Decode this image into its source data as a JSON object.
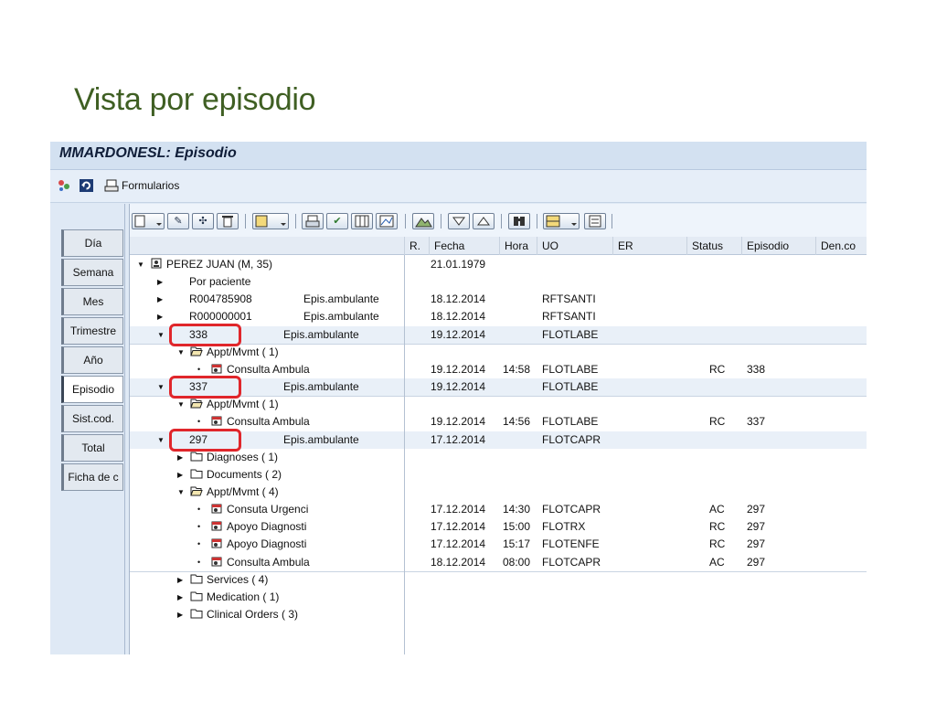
{
  "slide_title": "Vista por episodio",
  "window_title": "MMARDONESL: Episodio",
  "app_toolbar": {
    "forms_label": "Formularios"
  },
  "tabs": [
    "Día",
    "Semana",
    "Mes",
    "Trimestre",
    "Año",
    "Episodio",
    "Sist.cod.",
    "Total",
    "Ficha de c"
  ],
  "active_tab": "Episodio",
  "columns": [
    "R.",
    "Fecha",
    "Hora",
    "UO",
    "ER",
    "Status",
    "Episodio",
    "Den.co"
  ],
  "rows": [
    {
      "label": "PEREZ JUAN (M, 35)",
      "desc": "",
      "fecha": "21.01.1979",
      "hora": "",
      "uo": "",
      "status": "",
      "episodio": "",
      "level": 0,
      "node": "open",
      "icon": "patient-icon"
    },
    {
      "label": "Por paciente",
      "desc": "",
      "fecha": "",
      "hora": "",
      "uo": "",
      "status": "",
      "episodio": "",
      "level": 1,
      "node": "closed",
      "icon": ""
    },
    {
      "label": "R004785908",
      "desc": "Epis.ambulante",
      "fecha": "18.12.2014",
      "hora": "",
      "uo": "RFTSANTI",
      "status": "",
      "episodio": "",
      "level": 1,
      "node": "closed",
      "icon": ""
    },
    {
      "label": "R000000001",
      "desc": "Epis.ambulante",
      "fecha": "18.12.2014",
      "hora": "",
      "uo": "RFTSANTI",
      "status": "",
      "episodio": "",
      "level": 1,
      "node": "closed",
      "icon": ""
    },
    {
      "label": "338",
      "desc": "Epis.ambulante",
      "fecha": "19.12.2014",
      "hora": "",
      "uo": "FLOTLABE",
      "status": "",
      "episodio": "",
      "level": 1,
      "node": "open",
      "icon": "",
      "highlight": true
    },
    {
      "label": "Appt/Mvmt (  1)",
      "desc": "",
      "fecha": "",
      "hora": "",
      "uo": "",
      "status": "",
      "episodio": "",
      "level": 2,
      "node": "open",
      "icon": "folder-open-icon"
    },
    {
      "label": "Consulta Ambula",
      "desc": "",
      "fecha": "19.12.2014",
      "hora": "14:58",
      "uo": "FLOTLABE",
      "status": "RC",
      "episodio": "338",
      "level": 3,
      "node": "leaf",
      "icon": "appointment-icon"
    },
    {
      "label": "337",
      "desc": "Epis.ambulante",
      "fecha": "19.12.2014",
      "hora": "",
      "uo": "FLOTLABE",
      "status": "",
      "episodio": "",
      "level": 1,
      "node": "open",
      "icon": "",
      "highlight": true
    },
    {
      "label": "Appt/Mvmt (  1)",
      "desc": "",
      "fecha": "",
      "hora": "",
      "uo": "",
      "status": "",
      "episodio": "",
      "level": 2,
      "node": "open",
      "icon": "folder-open-icon"
    },
    {
      "label": "Consulta Ambula",
      "desc": "",
      "fecha": "19.12.2014",
      "hora": "14:56",
      "uo": "FLOTLABE",
      "status": "RC",
      "episodio": "337",
      "level": 3,
      "node": "leaf",
      "icon": "appointment-icon"
    },
    {
      "label": "297",
      "desc": "Epis.ambulante",
      "fecha": "17.12.2014",
      "hora": "",
      "uo": "FLOTCAPR",
      "status": "",
      "episodio": "",
      "level": 1,
      "node": "open",
      "icon": "",
      "highlight": true
    },
    {
      "label": "Diagnoses (  1)",
      "desc": "",
      "fecha": "",
      "hora": "",
      "uo": "",
      "status": "",
      "episodio": "",
      "level": 2,
      "node": "closed",
      "icon": "folder-icon"
    },
    {
      "label": "Documents (  2)",
      "desc": "",
      "fecha": "",
      "hora": "",
      "uo": "",
      "status": "",
      "episodio": "",
      "level": 2,
      "node": "closed",
      "icon": "folder-icon"
    },
    {
      "label": "Appt/Mvmt (  4)",
      "desc": "",
      "fecha": "",
      "hora": "",
      "uo": "",
      "status": "",
      "episodio": "",
      "level": 2,
      "node": "open",
      "icon": "folder-open-icon"
    },
    {
      "label": "Consuta Urgenci",
      "desc": "",
      "fecha": "17.12.2014",
      "hora": "14:30",
      "uo": "FLOTCAPR",
      "status": "AC",
      "episodio": "297",
      "level": 3,
      "node": "leaf",
      "icon": "appointment-icon"
    },
    {
      "label": "Apoyo Diagnosti",
      "desc": "",
      "fecha": "17.12.2014",
      "hora": "15:00",
      "uo": "FLOTRX",
      "status": "RC",
      "episodio": "297",
      "level": 3,
      "node": "leaf",
      "icon": "appointment-icon"
    },
    {
      "label": "Apoyo Diagnosti",
      "desc": "",
      "fecha": "17.12.2014",
      "hora": "15:17",
      "uo": "FLOTENFE",
      "status": "RC",
      "episodio": "297",
      "level": 3,
      "node": "leaf",
      "icon": "appointment-icon"
    },
    {
      "label": "Consulta Ambula",
      "desc": "",
      "fecha": "18.12.2014",
      "hora": "08:00",
      "uo": "FLOTCAPR",
      "status": "AC",
      "episodio": "297",
      "level": 3,
      "node": "leaf",
      "icon": "appointment-icon"
    },
    {
      "label": "Services (  4)",
      "desc": "",
      "fecha": "",
      "hora": "",
      "uo": "",
      "status": "",
      "episodio": "",
      "level": 2,
      "node": "closed",
      "icon": "folder-icon"
    },
    {
      "label": "Medication (  1)",
      "desc": "",
      "fecha": "",
      "hora": "",
      "uo": "",
      "status": "",
      "episodio": "",
      "level": 2,
      "node": "closed",
      "icon": "folder-icon"
    },
    {
      "label": "Clinical Orders (  3)",
      "desc": "",
      "fecha": "",
      "hora": "",
      "uo": "",
      "status": "",
      "episodio": "",
      "level": 2,
      "node": "closed",
      "icon": "folder-icon"
    }
  ],
  "colors": {
    "title_green": "#3f5f23",
    "highlight_red": "#e0262b",
    "panel_blue": "#dfe9f5"
  }
}
